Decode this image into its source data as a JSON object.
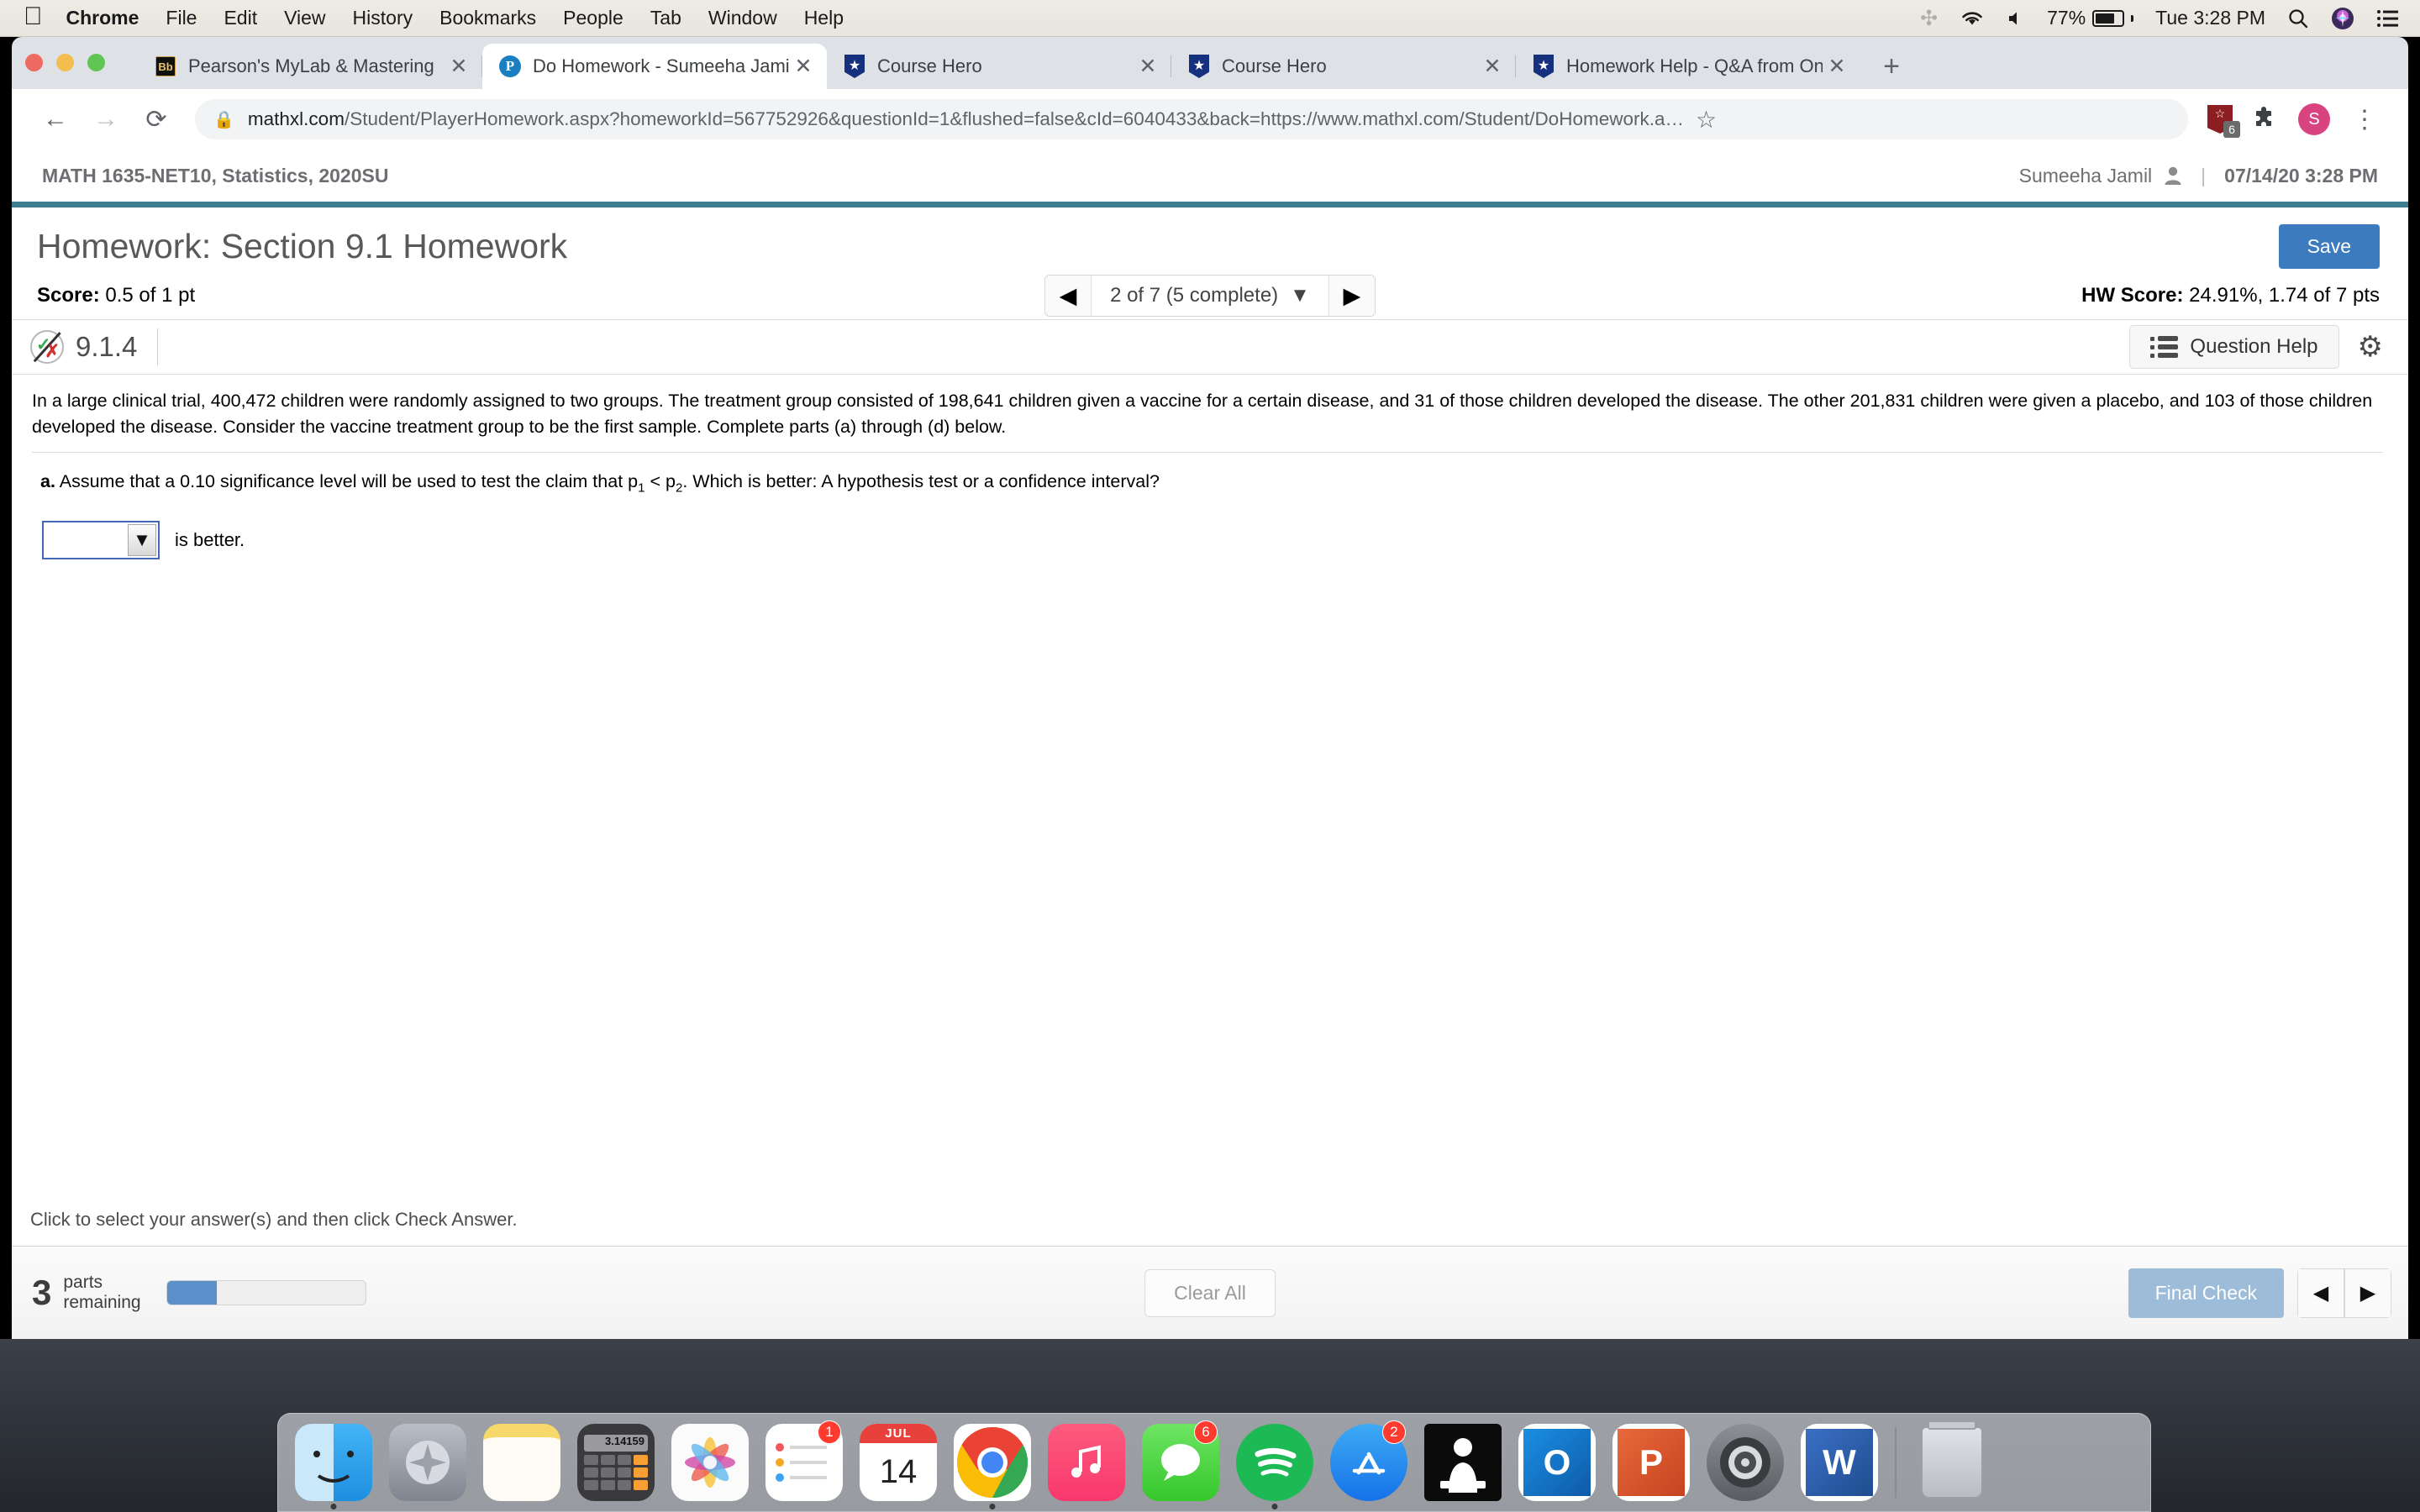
{
  "menubar": {
    "apple": "",
    "items": [
      {
        "label": "Chrome",
        "bold": true
      },
      {
        "label": "File",
        "bold": false
      },
      {
        "label": "Edit",
        "bold": false
      },
      {
        "label": "View",
        "bold": false
      },
      {
        "label": "History",
        "bold": false
      },
      {
        "label": "Bookmarks",
        "bold": false
      },
      {
        "label": "People",
        "bold": false
      },
      {
        "label": "Tab",
        "bold": false
      },
      {
        "label": "Window",
        "bold": false
      },
      {
        "label": "Help",
        "bold": false
      }
    ],
    "bluetooth_icon": "bluetooth-icon",
    "wifi_icon": "wifi-icon",
    "volume_icon": "volume-icon",
    "battery_percent": "77%",
    "clock": "Tue 3:28 PM",
    "search_icon": "spotlight-search-icon",
    "siri_icon": "siri-icon",
    "control_center_icon": "control-center-icon"
  },
  "browser": {
    "tabs": [
      {
        "title": "Pearson's MyLab & Mastering",
        "favicon": "blackboard-favicon",
        "active": false
      },
      {
        "title": "Do Homework - Sumeeha Jami",
        "favicon": "pearson-favicon",
        "active": true
      },
      {
        "title": "Course Hero",
        "favicon": "coursehero-favicon",
        "active": false
      },
      {
        "title": "Course Hero",
        "favicon": "coursehero-favicon",
        "active": false
      },
      {
        "title": "Homework Help - Q&A from On",
        "favicon": "coursehero-favicon",
        "active": false
      }
    ],
    "new_tab_label": "+",
    "close_label": "✕",
    "back_icon": "back-arrow-icon",
    "forward_icon": "forward-arrow-icon",
    "reload_icon": "reload-icon",
    "url_host": "mathxl.com",
    "url_rest": "/Student/PlayerHomework.aspx?homeworkId=567752926&questionId=1&flushed=false&cId=6040433&back=https://www.mathxl.com/Student/DoHomework.a…",
    "bookmark_icon": "star-icon",
    "extension_badge_count": "6",
    "puzzle_icon": "extensions-puzzle-icon",
    "profile_initial": "S",
    "menu_icon": "chrome-menu-icon"
  },
  "mathxl": {
    "course": "MATH 1635-NET10, Statistics, 2020SU",
    "user": "Sumeeha Jamil",
    "user_icon": "user-avatar-icon",
    "separator": "|",
    "datetime": "07/14/20 3:28 PM",
    "title": "Homework: Section 9.1 Homework",
    "save_label": "Save",
    "score_label": "Score:",
    "score_value": "0.5 of 1 pt",
    "pager": {
      "prev_icon": "prev-triangle-icon",
      "next_icon": "next-triangle-icon",
      "label": "2 of 7 (5 complete)",
      "caret": "▼"
    },
    "hw_score_label": "HW Score:",
    "hw_score_value": "24.91%, 1.74 of 7 pts",
    "question_number": "9.1.4",
    "question_status_icon": "partial-credit-check-x-icon",
    "question_help_label": "Question Help",
    "question_help_icon": "list-icon",
    "settings_icon": "gear-icon",
    "question_text": "In a large clinical trial, 400,472 children were randomly assigned to two groups. The treatment group consisted of 198,641 children given a vaccine for a certain disease, and 31 of those children developed the disease. The other 201,831 children were given a placebo, and 103 of those children developed the disease. Consider the vaccine treatment group to be the first sample. Complete parts (a) through (d) below.",
    "part_a_label": "a.",
    "part_a_text_1": "Assume that a 0.10 significance level will be used to test the claim that p",
    "part_a_sub_1": "1",
    "part_a_text_2": " < p",
    "part_a_sub_2": "2",
    "part_a_text_3": ". Which is better: A hypothesis test or a confidence interval?",
    "answer_dropdown_value": "",
    "answer_dropdown_caret": "▼",
    "answer_suffix": "is better.",
    "footer_instruction": "Click to select your answer(s) and then click Check Answer.",
    "help_badge": "?",
    "parts_remaining_number": "3",
    "parts_remaining_line1": "parts",
    "parts_remaining_line2": "remaining",
    "progress_percent": 25,
    "clear_all_label": "Clear All",
    "final_check_label": "Final Check",
    "nav_prev_icon": "prev-triangle-icon",
    "nav_next_icon": "next-triangle-icon"
  },
  "dock": {
    "items": [
      {
        "name": "finder",
        "label": "",
        "color": "#3aa0f2",
        "badge": "",
        "running": true
      },
      {
        "name": "launchpad",
        "label": "",
        "color": "#9aa3ad",
        "badge": "",
        "running": false
      },
      {
        "name": "notes",
        "label": "",
        "color": "#fcd966",
        "badge": "",
        "running": false
      },
      {
        "name": "calculator",
        "label": "",
        "color": "#4a4a4a",
        "badge": "",
        "running": false
      },
      {
        "name": "photos",
        "label": "",
        "color": "#f7f7f7",
        "badge": "",
        "running": false
      },
      {
        "name": "reminders",
        "label": "",
        "color": "#ffffff",
        "badge": "1",
        "running": false
      },
      {
        "name": "calendar",
        "label": "14",
        "color": "#ffffff",
        "badge": "",
        "running": false
      },
      {
        "name": "chrome",
        "label": "",
        "color": "#ffffff",
        "badge": "",
        "running": true
      },
      {
        "name": "music",
        "label": "",
        "color": "#fc4f6b",
        "badge": "",
        "running": false
      },
      {
        "name": "messages",
        "label": "",
        "color": "#5fd34d",
        "badge": "6",
        "running": false
      },
      {
        "name": "spotify",
        "label": "",
        "color": "#1db954",
        "badge": "",
        "running": true
      },
      {
        "name": "app-store",
        "label": "",
        "color": "#2b8af0",
        "badge": "2",
        "running": false
      },
      {
        "name": "kindle",
        "label": "",
        "color": "#0b0b0b",
        "badge": "",
        "running": false
      },
      {
        "name": "outlook",
        "label": "O",
        "color": "#0f6cbd",
        "badge": "",
        "running": false
      },
      {
        "name": "powerpoint",
        "label": "P",
        "color": "#d04423",
        "badge": "",
        "running": false
      },
      {
        "name": "system-preferences",
        "label": "",
        "color": "#6e6e73",
        "badge": "",
        "running": false
      },
      {
        "name": "word",
        "label": "W",
        "color": "#2b579a",
        "badge": "",
        "running": false
      }
    ],
    "trash_label": "trash"
  }
}
